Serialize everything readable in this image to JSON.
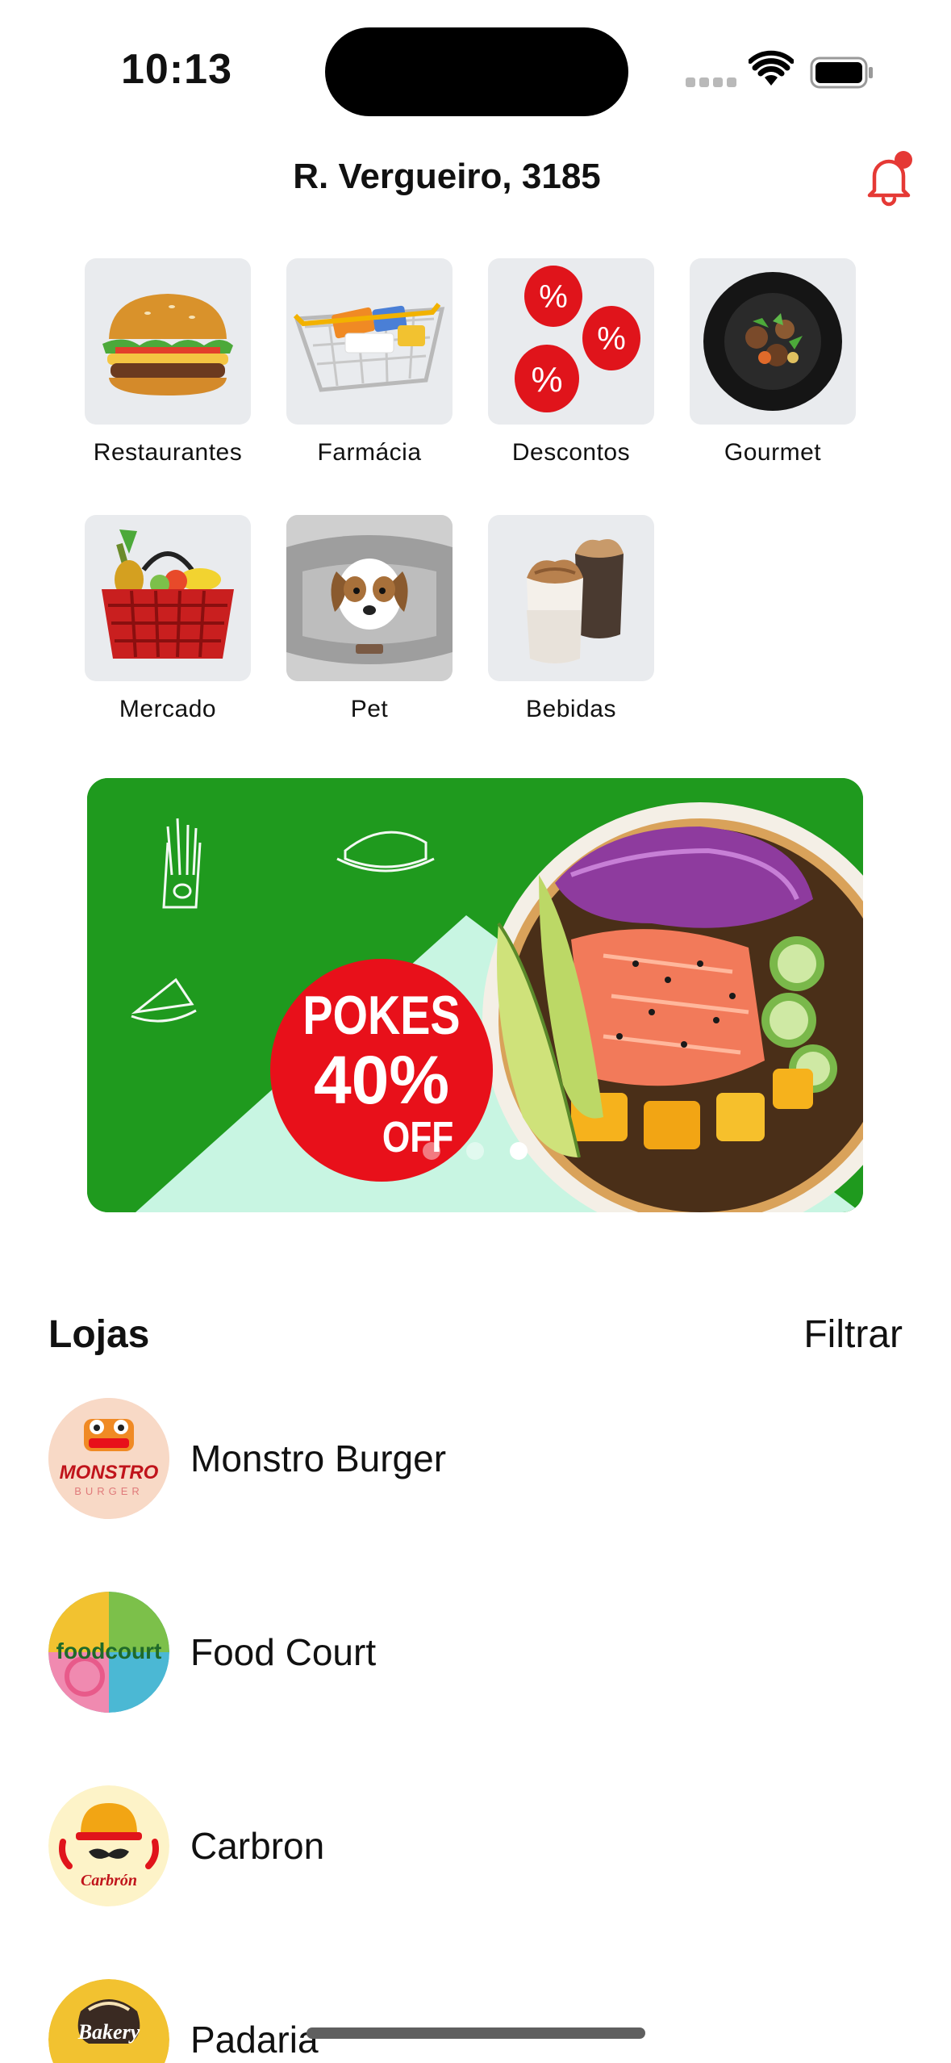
{
  "status": {
    "time": "10:13"
  },
  "header": {
    "address": "R. Vergueiro, 3185"
  },
  "categories": [
    {
      "label": "Restaurantes",
      "icon": "burger-icon"
    },
    {
      "label": "Farmácia",
      "icon": "pharmacy-basket-icon"
    },
    {
      "label": "Descontos",
      "icon": "discount-balloons-icon"
    },
    {
      "label": "Gourmet",
      "icon": "gourmet-plate-icon"
    },
    {
      "label": "Mercado",
      "icon": "market-basket-icon"
    },
    {
      "label": "Pet",
      "icon": "pet-dog-icon"
    },
    {
      "label": "Bebidas",
      "icon": "drinks-icon"
    }
  ],
  "banner": {
    "line1": "POKES",
    "line2": "40%",
    "line3": "OFF",
    "active_slide": 3,
    "total_slides": 3
  },
  "stores_section": {
    "title": "Lojas",
    "filter_label": "Filtrar"
  },
  "stores": [
    {
      "name": "Monstro Burger",
      "logo_text": "MONSTRO",
      "logo_sub": "BURGER"
    },
    {
      "name": "Food Court",
      "logo_text": "foodcourt"
    },
    {
      "name": "Carbron",
      "logo_text": "Carbrón"
    },
    {
      "name": "Padaria",
      "logo_text": "Bakery"
    }
  ],
  "colors": {
    "accent": "#e53935",
    "banner_green": "#1f9a1e",
    "tile_bg": "#e9ebee"
  }
}
